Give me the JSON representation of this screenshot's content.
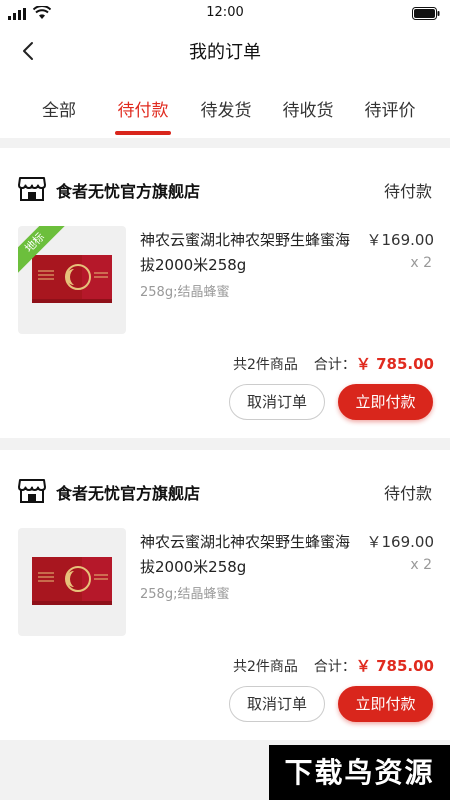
{
  "status_bar": {
    "time": "12:00"
  },
  "header": {
    "title": "我的订单"
  },
  "tabs": [
    {
      "label": "全部"
    },
    {
      "label": "待付款"
    },
    {
      "label": "待发货"
    },
    {
      "label": "待收货"
    },
    {
      "label": "待评价"
    }
  ],
  "active_tab": "待付款",
  "orders": [
    {
      "store_name": "食者无忧官方旗舰店",
      "status": "待付款",
      "product": {
        "title": "神农云蜜湖北神农架野生蜂蜜海拔2000米258g",
        "spec": "258g;结晶蜂蜜",
        "price": "￥169.00",
        "quantity": "x 2",
        "badge": "地标"
      },
      "summary": {
        "count": "共2件商品",
        "total_label": "合计：",
        "total_value": "￥ 785.00"
      },
      "buttons": {
        "cancel": "取消订单",
        "pay": "立即付款"
      }
    },
    {
      "store_name": "食者无忧官方旗舰店",
      "status": "待付款",
      "product": {
        "title": "神农云蜜湖北神农架野生蜂蜜海拔2000米258g",
        "spec": "258g;结晶蜂蜜",
        "price": "￥169.00",
        "quantity": "x 2"
      },
      "summary": {
        "count": "共2件商品",
        "total_label": "合计：",
        "total_value": "￥ 785.00"
      },
      "buttons": {
        "cancel": "取消订单",
        "pay": "立即付款"
      }
    }
  ],
  "watermark": "下载鸟资源",
  "colors": {
    "accent": "#d9261c",
    "price": "#e02b1f",
    "badge": "#6cbf3c",
    "product_box": "#a8161f"
  }
}
